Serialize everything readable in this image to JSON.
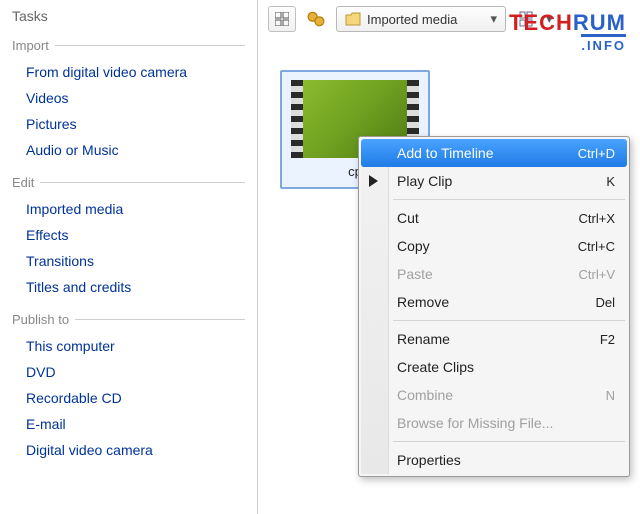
{
  "tasks_title": "Tasks",
  "sections": {
    "import": {
      "header": "Import",
      "items": [
        "From digital video camera",
        "Videos",
        "Pictures",
        "Audio or Music"
      ]
    },
    "edit": {
      "header": "Edit",
      "items": [
        "Imported media",
        "Effects",
        "Transitions",
        "Titles and credits"
      ]
    },
    "publish": {
      "header": "Publish to",
      "items": [
        "This computer",
        "DVD",
        "Recordable CD",
        "E-mail",
        "Digital video camera"
      ]
    }
  },
  "toolbar": {
    "dropdown_label": "Imported media"
  },
  "clip": {
    "caption": "cp"
  },
  "watermark": {
    "top_red": "TECH",
    "top_blue": "RUM",
    "bottom": ".INFO"
  },
  "context_menu": [
    {
      "label": "Add to Timeline",
      "shortcut": "Ctrl+D",
      "highlight": true
    },
    {
      "label": "Play Clip",
      "shortcut": "K",
      "play": true
    },
    {
      "sep": true
    },
    {
      "label": "Cut",
      "shortcut": "Ctrl+X"
    },
    {
      "label": "Copy",
      "shortcut": "Ctrl+C"
    },
    {
      "label": "Paste",
      "shortcut": "Ctrl+V",
      "disabled": true
    },
    {
      "label": "Remove",
      "shortcut": "Del"
    },
    {
      "sep": true
    },
    {
      "label": "Rename",
      "shortcut": "F2"
    },
    {
      "label": "Create Clips"
    },
    {
      "label": "Combine",
      "shortcut": "N",
      "disabled": true
    },
    {
      "label": "Browse for Missing File...",
      "disabled": true
    },
    {
      "sep": true
    },
    {
      "label": "Properties"
    }
  ]
}
